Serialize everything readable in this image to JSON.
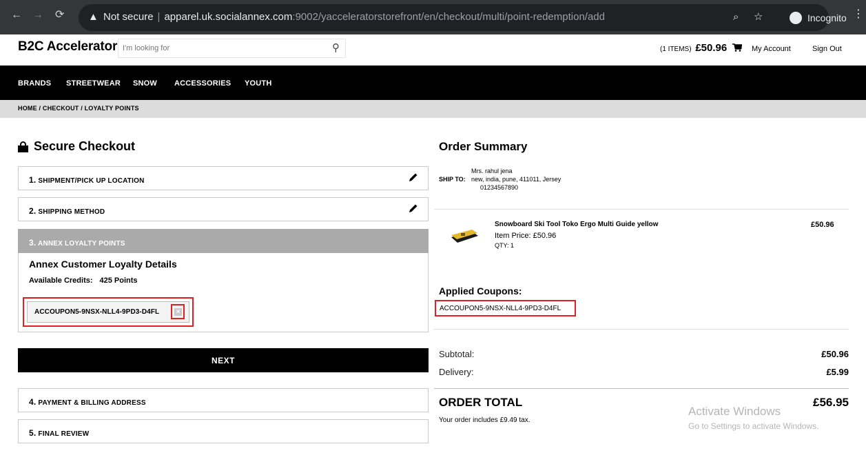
{
  "browser": {
    "security_label": "Not secure",
    "url_host": "apparel.uk.socialannex.com",
    "url_rest": ":9002/yacceleratorstorefront/en/checkout/multi/point-redemption/add",
    "profile_label": "Incognito"
  },
  "header": {
    "logo": "B2C Accelerator",
    "search_placeholder": "I'm looking for",
    "cart_items": "(1 ITEMS)",
    "cart_amount": "£50.96",
    "my_account": "My Account",
    "sign_out": "Sign Out"
  },
  "nav": {
    "items": [
      "BRANDS",
      "STREETWEAR",
      "SNOW",
      "ACCESSORIES",
      "YOUTH"
    ]
  },
  "breadcrumb": "HOME  /  CHECKOUT  /  LOYALTY POINTS",
  "checkout": {
    "title": "Secure Checkout",
    "steps": [
      {
        "num": "1.",
        "label": "SHIPMENT/PICK UP LOCATION"
      },
      {
        "num": "2.",
        "label": "SHIPPING METHOD"
      },
      {
        "num": "3.",
        "label": "ANNEX LOYALTY POINTS"
      },
      {
        "num": "4.",
        "label": "PAYMENT & BILLING ADDRESS"
      },
      {
        "num": "5.",
        "label": "FINAL REVIEW"
      }
    ],
    "loyalty_title": "Annex Customer Loyalty Details",
    "credits_label": "Available Credits:",
    "credits_value": "425 Points",
    "coupon_code": "ACCOUPON5-9NSX-NLL4-9PD3-D4FL",
    "next_label": "NEXT"
  },
  "summary": {
    "title": "Order Summary",
    "ship_to_label": "SHIP TO:",
    "ship_to_lines": [
      "Mrs. rahul jena",
      "new,  india,  pune,  411011,  Jersey",
      "01234567890"
    ],
    "item_name": "Snowboard Ski Tool Toko Ergo Multi Guide yellow",
    "item_price": "Item Price:  £50.96",
    "item_qty": "QTY:  1",
    "item_total": "£50.96",
    "applied_title": "Applied Coupons:",
    "applied_code": "ACCOUPON5-9NSX-NLL4-9PD3-D4FL",
    "subtotal_label": "Subtotal:",
    "subtotal_value": "£50.96",
    "delivery_label": "Delivery:",
    "delivery_value": "£5.99",
    "order_total_label": "ORDER TOTAL",
    "order_total_value": "£56.95",
    "tax_note": "Your order includes £9.49 tax."
  },
  "watermark": {
    "line1": "Activate Windows",
    "line2": "Go to Settings to activate Windows."
  }
}
